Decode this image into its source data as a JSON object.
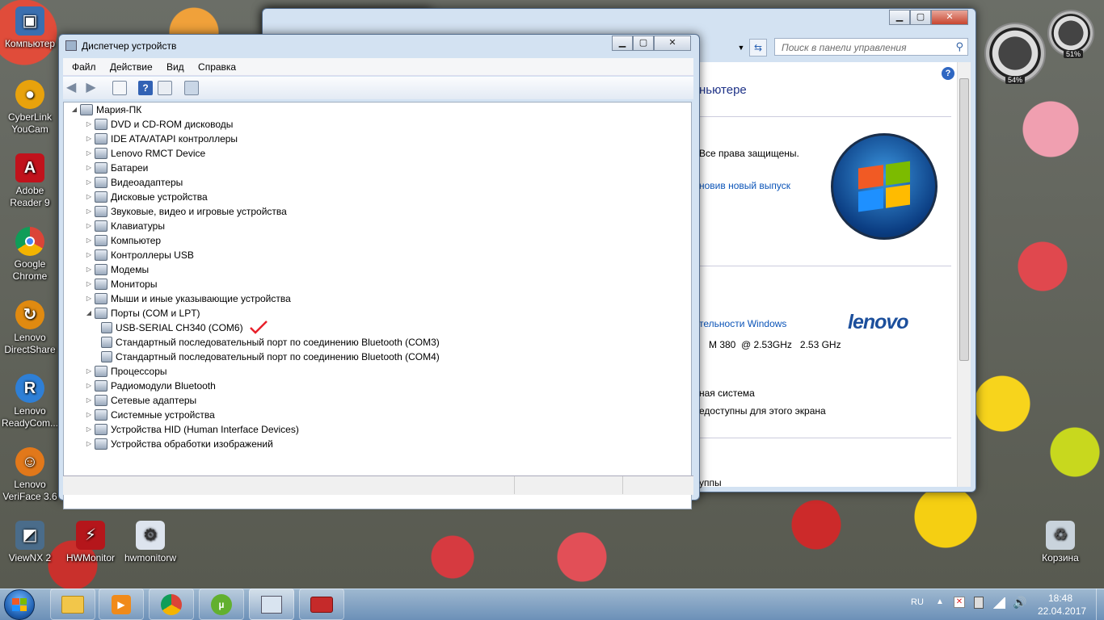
{
  "desktop": {
    "icons": [
      {
        "label": "Компьютер"
      },
      {
        "label": "CyberLink YouCam"
      },
      {
        "label": "Adobe Reader 9"
      },
      {
        "label": "Google Chrome"
      },
      {
        "label": "Lenovo DirectShare"
      },
      {
        "label": "Lenovo ReadyCom..."
      },
      {
        "label": "Lenovo VeriFace 3.6"
      },
      {
        "label": "ViewNX 2"
      },
      {
        "label": "HWMonitor"
      },
      {
        "label": "hwmonitorw"
      },
      {
        "label": "Корзина"
      }
    ],
    "gadget": {
      "cpu": "54%",
      "mem": "51%"
    }
  },
  "cp_window": {
    "search_placeholder": "Поиск в панели управления",
    "heading": "ньютере",
    "rights": "Все права защищены.",
    "link_new_release": "новив новый выпуск",
    "perf_link": "тельности Windows",
    "processor": "M 380  @ 2.53GHz   2.53 GHz",
    "system_type": "ная система",
    "pen_touch": "едоступны для этого экрана",
    "workgroup": "уппы",
    "lenovo": "lenovo"
  },
  "devmgr": {
    "title": "Диспетчер устройств",
    "menu": [
      "Файл",
      "Действие",
      "Вид",
      "Справка"
    ],
    "root": "Мария-ПК",
    "categories": [
      {
        "label": "DVD и CD-ROM дисководы"
      },
      {
        "label": "IDE ATA/ATAPI контроллеры"
      },
      {
        "label": "Lenovo RMCT Device"
      },
      {
        "label": "Батареи"
      },
      {
        "label": "Видеоадаптеры"
      },
      {
        "label": "Дисковые устройства"
      },
      {
        "label": "Звуковые, видео и игровые устройства"
      },
      {
        "label": "Клавиатуры"
      },
      {
        "label": "Компьютер"
      },
      {
        "label": "Контроллеры USB"
      },
      {
        "label": "Модемы"
      },
      {
        "label": "Мониторы"
      },
      {
        "label": "Мыши и иные указывающие устройства"
      },
      {
        "label": "Порты (COM и LPT)"
      },
      {
        "label": "Процессоры"
      },
      {
        "label": "Радиомодули Bluetooth"
      },
      {
        "label": "Сетевые адаптеры"
      },
      {
        "label": "Системные устройства"
      },
      {
        "label": "Устройства HID (Human Interface Devices)"
      },
      {
        "label": "Устройства обработки изображений"
      }
    ],
    "ports": [
      {
        "label": "USB-SERIAL CH340 (COM6)"
      },
      {
        "label": "Стандартный последовательный порт по соединению Bluetooth (COM3)"
      },
      {
        "label": "Стандартный последовательный порт по соединению Bluetooth (COM4)"
      }
    ],
    "checkmark_color": "#e8202a"
  },
  "taskbar": {
    "lang": "RU",
    "time": "18:48",
    "date": "22.04.2017"
  }
}
